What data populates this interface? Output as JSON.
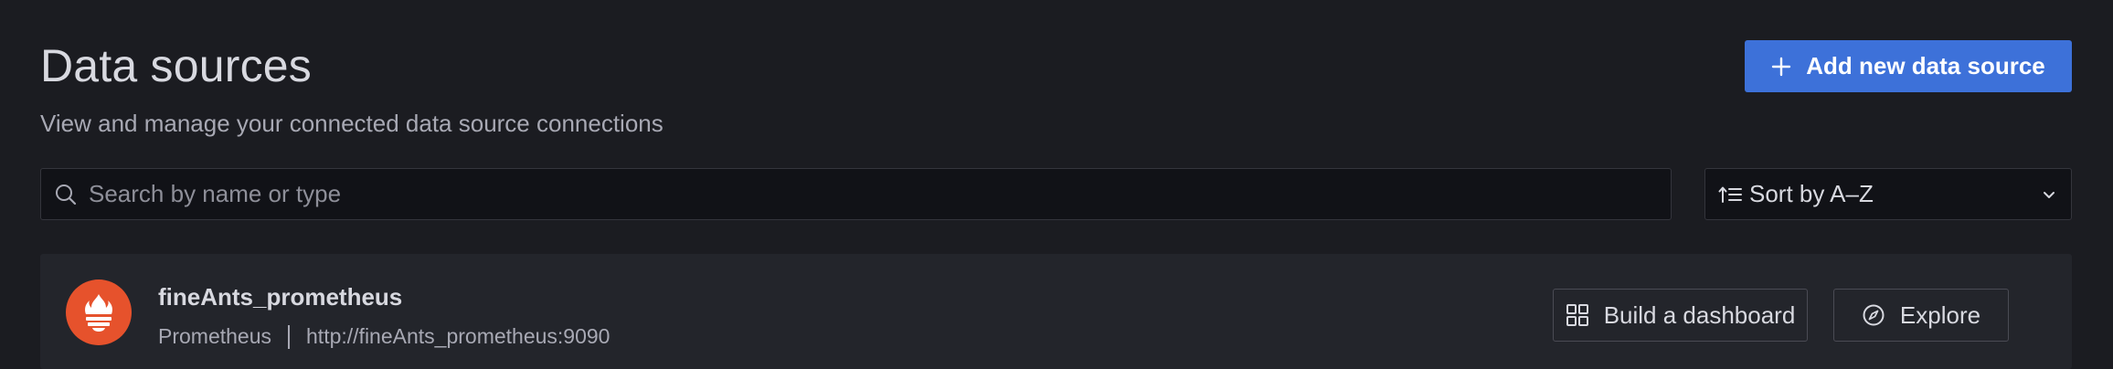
{
  "header": {
    "title": "Data sources",
    "subtitle": "View and manage your connected data source connections"
  },
  "toolbar": {
    "add_button_label": "Add new data source"
  },
  "search": {
    "placeholder": "Search by name or type",
    "value": ""
  },
  "sort": {
    "selected": "Sort by A–Z"
  },
  "datasources": [
    {
      "name": "fineAnts_prometheus",
      "type": "Prometheus",
      "url": "http://fineAnts_prometheus:9090",
      "logo_color": "#e6522c",
      "logo_icon": "prometheus-icon",
      "actions": {
        "build_dashboard": "Build a dashboard",
        "explore": "Explore"
      }
    }
  ],
  "colors": {
    "background": "#1b1c21",
    "primary_button": "#3d71d9",
    "card_background": "#23252b",
    "input_background": "#111217"
  }
}
